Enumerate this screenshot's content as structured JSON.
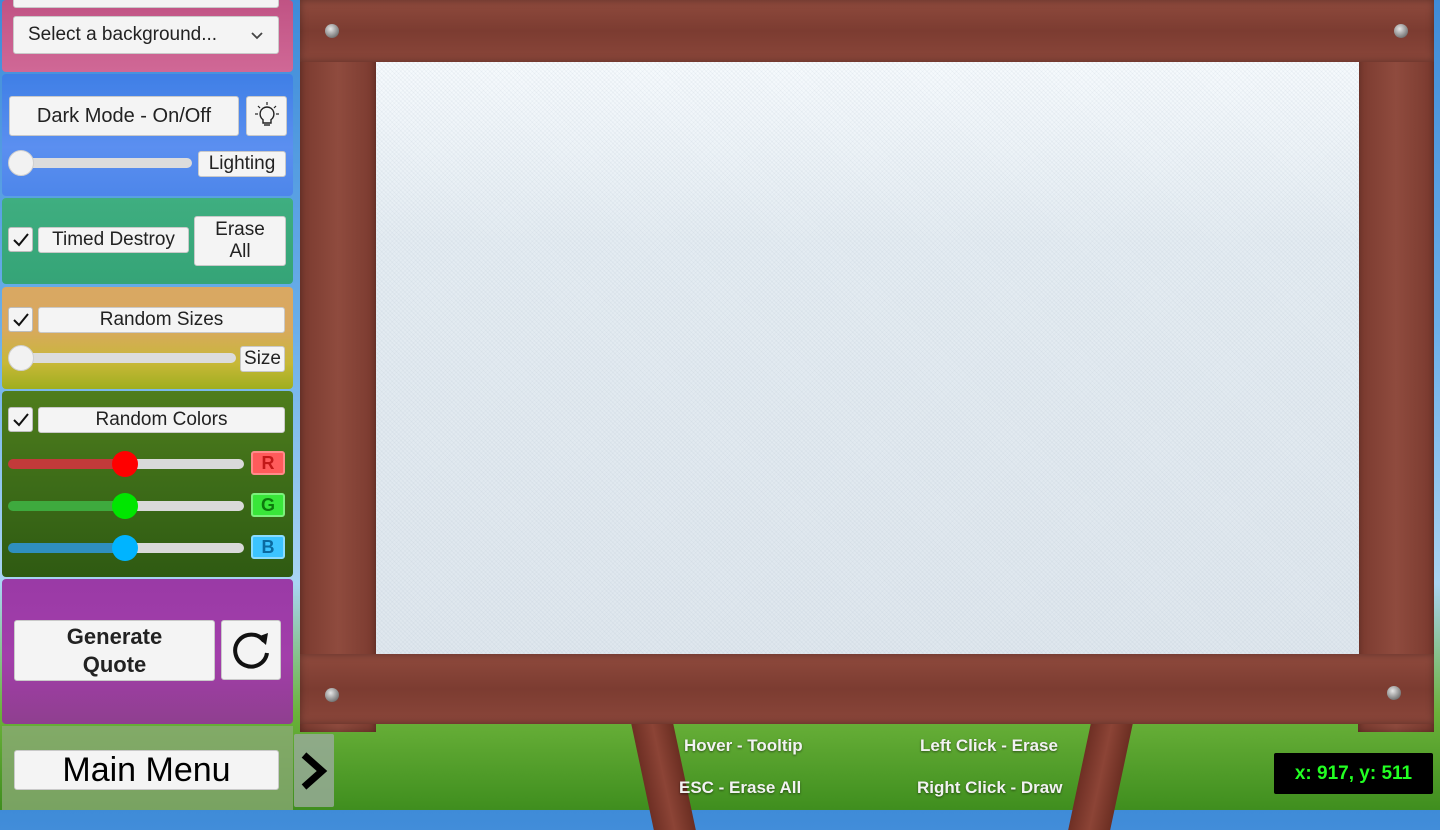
{
  "background_select": {
    "value": "Select a background...",
    "chevron_icon": "chevron-down-icon"
  },
  "lighting": {
    "dark_mode_label": "Dark Mode - On/Off",
    "lightbulb_icon": "lightbulb-icon",
    "slider_label": "Lighting",
    "slider_value": 0
  },
  "erase": {
    "timed_destroy_label": "Timed Destroy",
    "timed_destroy_checked": true,
    "erase_all_label": "Erase All"
  },
  "sizes": {
    "random_sizes_label": "Random Sizes",
    "random_sizes_checked": true,
    "slider_label": "Size",
    "slider_value": 0
  },
  "colors": {
    "random_colors_label": "Random Colors",
    "random_colors_checked": true,
    "r_label": "R",
    "g_label": "G",
    "b_label": "B",
    "r_value": 0.5,
    "g_value": 0.5,
    "b_value": 0.5,
    "r_color": "#ff0000",
    "g_color": "#00e600",
    "b_color": "#00b4ff"
  },
  "quote": {
    "generate_label": "Generate Quote",
    "refresh_icon": "refresh-icon"
  },
  "menu": {
    "main_menu_label": "Main Menu",
    "arrow_icon": "chevron-right-icon"
  },
  "hints": {
    "hover": "Hover - Tooltip",
    "left_click": "Left Click - Erase",
    "esc": "ESC - Erase All",
    "right_click": "Right Click - Draw"
  },
  "cursor_readout": "x: 917, y: 511"
}
